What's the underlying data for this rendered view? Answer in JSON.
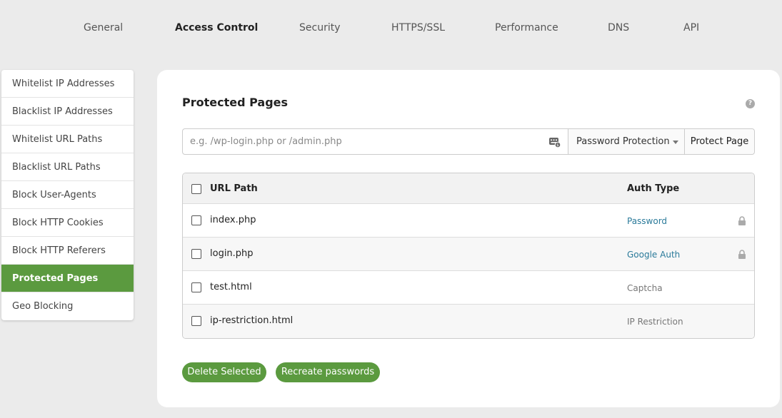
{
  "nav": {
    "tabs": [
      {
        "label": "General"
      },
      {
        "label": "Access Control",
        "active": true
      },
      {
        "label": "Security"
      },
      {
        "label": "HTTPS/SSL"
      },
      {
        "label": "Performance"
      },
      {
        "label": "DNS"
      },
      {
        "label": "API"
      }
    ]
  },
  "sidebar": {
    "items": [
      {
        "label": "Whitelist IP Addresses"
      },
      {
        "label": "Blacklist IP Addresses"
      },
      {
        "label": "Whitelist URL Paths"
      },
      {
        "label": "Blacklist URL Paths"
      },
      {
        "label": "Block User-Agents"
      },
      {
        "label": "Block HTTP Cookies"
      },
      {
        "label": "Block HTTP Referers"
      },
      {
        "label": "Protected Pages",
        "active": true
      },
      {
        "label": "Geo Blocking"
      }
    ]
  },
  "panel": {
    "title": "Protected Pages",
    "help_icon": "question-circle-icon",
    "input": {
      "value": "",
      "placeholder": "e.g. /wp-login.php or /admin.php",
      "icon": "keyboard-icon"
    },
    "select": {
      "selected": "Password Protection"
    },
    "protect_button": "Protect Page",
    "table": {
      "headers": {
        "path": "URL Path",
        "auth": "Auth Type"
      },
      "rows": [
        {
          "path": "index.php",
          "auth": "Password",
          "locked": true
        },
        {
          "path": "login.php",
          "auth": "Google Auth",
          "locked": true
        },
        {
          "path": "test.html",
          "auth": "Captcha",
          "locked": false
        },
        {
          "path": "ip-restriction.html",
          "auth": "IP Restriction",
          "locked": false
        }
      ]
    },
    "buttons": {
      "delete": "Delete Selected",
      "recreate": "Recreate passwords"
    }
  },
  "colors": {
    "accent": "#5b9a3f",
    "link": "#2a7a9a"
  }
}
